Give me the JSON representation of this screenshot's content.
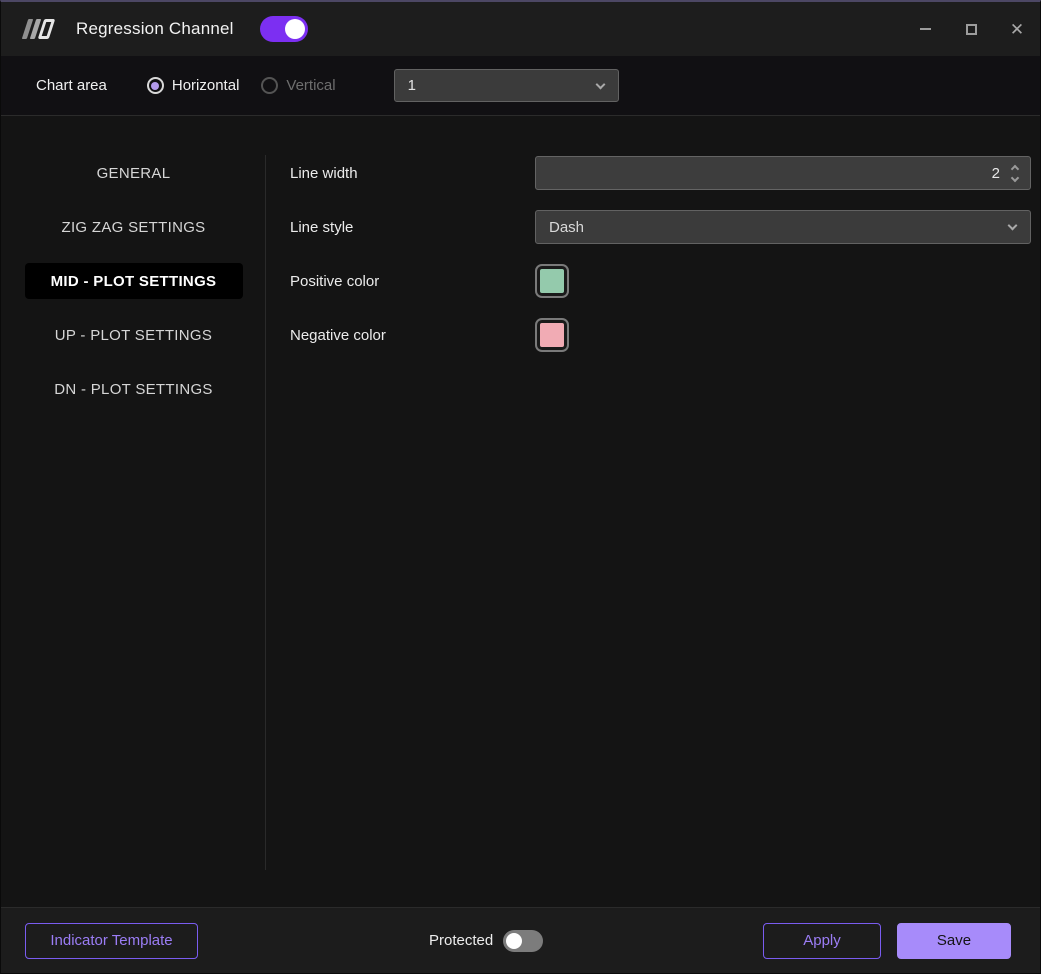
{
  "window": {
    "title": "Regression Channel",
    "enabled_toggle_on": true,
    "icons": {
      "logo": "striped-logo",
      "minimize": "minimize-dash",
      "maximize": "maximize-square",
      "close": "✕",
      "chevron_down": "⌄"
    }
  },
  "toolbar": {
    "chart_area_label": "Chart area",
    "orientation_options": [
      {
        "label": "Horizontal",
        "selected": true,
        "enabled": true
      },
      {
        "label": "Vertical",
        "selected": false,
        "enabled": false
      }
    ],
    "chart_number_value": "1"
  },
  "sidebar": {
    "tabs": [
      {
        "label": "GENERAL",
        "selected": false
      },
      {
        "label": "ZIG ZAG SETTINGS",
        "selected": false
      },
      {
        "label": "MID - PLOT SETTINGS",
        "selected": true
      },
      {
        "label": "UP - PLOT SETTINGS",
        "selected": false
      },
      {
        "label": "DN - PLOT SETTINGS",
        "selected": false
      }
    ]
  },
  "settings": {
    "line_width": {
      "label": "Line width",
      "value": "2"
    },
    "line_style": {
      "label": "Line style",
      "value": "Dash"
    },
    "positive_color": {
      "label": "Positive color",
      "value": "#94caac"
    },
    "negative_color": {
      "label": "Negative color",
      "value": "#f1abb4"
    }
  },
  "footer": {
    "indicator_template_label": "Indicator Template",
    "protected_label": "Protected",
    "protected_toggle_on": false,
    "apply_label": "Apply",
    "save_label": "Save"
  },
  "colors": {
    "accent": "#7c2ff2",
    "accent_light": "#a78bfa",
    "accent_text": "#9b7df5",
    "positive": "#94caac",
    "negative": "#f1abb4",
    "selected_tab_bg": "#000000"
  }
}
